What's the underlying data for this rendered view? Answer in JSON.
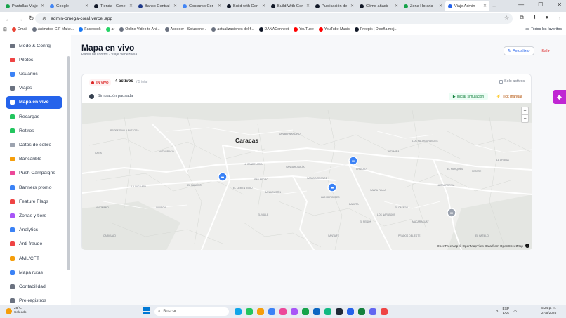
{
  "browser": {
    "tabs": [
      {
        "title": "Pantallas Viaje",
        "color": "#16a34a"
      },
      {
        "title": "Google",
        "color": "#4285f4"
      },
      {
        "title": "Tienda - Gene",
        "color": "#111827"
      },
      {
        "title": "Banco Central",
        "color": "#1e3a8a"
      },
      {
        "title": "Concurso Cor",
        "color": "#4285f4"
      },
      {
        "title": "Build with Ger",
        "color": "#111827"
      },
      {
        "title": "Build With Ger",
        "color": "#111827"
      },
      {
        "title": "Publicación de",
        "color": "#111827"
      },
      {
        "title": "Cómo añadir",
        "color": "#111827"
      },
      {
        "title": "Zona Horaria",
        "color": "#16a34a"
      },
      {
        "title": "Viaje Admin",
        "color": "#2563eb"
      }
    ],
    "url": "admin-omega-coral.vercel.app",
    "bookmarks": [
      {
        "label": "Gmail",
        "color": "#ea4335"
      },
      {
        "label": "Animated GIF Make...",
        "color": "#6b7280"
      },
      {
        "label": "Facebook",
        "color": "#1877f2"
      },
      {
        "label": "ar",
        "color": "#25d366"
      },
      {
        "label": "Online Video to Ani...",
        "color": "#6b7280"
      },
      {
        "label": "Acceder - Solucione...",
        "color": "#6b7280"
      },
      {
        "label": "actualizaciones del f...",
        "color": "#6b7280"
      },
      {
        "label": "DANAConnect",
        "color": "#111827"
      },
      {
        "label": "YouTube",
        "color": "#ff0000"
      },
      {
        "label": "YouTube Music",
        "color": "#ff0000"
      },
      {
        "label": "Freepik | Diseña mej...",
        "color": "#111827"
      }
    ],
    "all_bookmarks": "Todos los favoritos"
  },
  "sidebar": {
    "items": [
      {
        "label": "Modo & Config",
        "color": "#6b7280"
      },
      {
        "label": "Pilotos",
        "color": "#ef4444"
      },
      {
        "label": "Usuarios",
        "color": "#3b82f6"
      },
      {
        "label": "Viajes",
        "color": "#6b7280"
      },
      {
        "label": "Mapa en vivo",
        "color": "#ef4444",
        "active": true
      },
      {
        "label": "Recargas",
        "color": "#22c55e"
      },
      {
        "label": "Retiros",
        "color": "#22c55e"
      },
      {
        "label": "Datos de cobro",
        "color": "#9ca3af"
      },
      {
        "label": "Bancarible",
        "color": "#f59e0b"
      },
      {
        "label": "Push Campaigns",
        "color": "#ec4899"
      },
      {
        "label": "Banners promo",
        "color": "#3b82f6"
      },
      {
        "label": "Feature Flags",
        "color": "#ef4444"
      },
      {
        "label": "Zonas y tiers",
        "color": "#a855f7"
      },
      {
        "label": "Analytics",
        "color": "#3b82f6"
      },
      {
        "label": "Anti-fraude",
        "color": "#ef4444"
      },
      {
        "label": "AML/CFT",
        "color": "#f59e0b"
      },
      {
        "label": "Mapa rutas",
        "color": "#3b82f6"
      },
      {
        "label": "Contabilidad",
        "color": "#6b7280"
      },
      {
        "label": "Pre-registros",
        "color": "#6b7280"
      }
    ]
  },
  "header": {
    "title": "Mapa en vivo",
    "subtitle": "Panel de control · Viaje Venezuela",
    "refresh_label": "Actualizar",
    "logout_label": "Salir"
  },
  "panel": {
    "live_badge": "EN VIVO",
    "active_count": "4 activos",
    "total": "/ 5 total",
    "only_active": "Solo activos",
    "sim_status": "Simulación pausada",
    "start_sim": "Iniciar simulación",
    "tick": "Tick manual"
  },
  "map": {
    "city_label": "Caracas",
    "places": [
      "LA PASTORA",
      "ALTAGRACIA",
      "SAN BERNARDINO",
      "LA CANDELARIA",
      "SAN AGUSTÍN",
      "EL PARAÍSO",
      "CATIA",
      "PROPATRIA",
      "SANTA ROSALÍA",
      "SAN PEDRO",
      "EL CEMENTERIO",
      "LA VEGA",
      "EL VALLE",
      "CHACAO",
      "ALTAMIRA",
      "LOS PALOS GRANDES",
      "SABANA GRANDE",
      "LAS MERCEDES",
      "BARUTA",
      "EL CAFETAL",
      "PETARE",
      "LA URBINA",
      "LA CALIFORNIA",
      "EL MARQUÉS",
      "PRADOS DEL ESTE",
      "SANTA FE",
      "EL HATILLO",
      "LA YAGUARA",
      "ANTÍMANO",
      "CARICUAO",
      "MACARACUAY",
      "EL PEÑÓN",
      "SANTA PAULA",
      "LOS NARANJOS"
    ],
    "zoom_in": "+",
    "zoom_out": "−",
    "attribution": "OpenFreeMap © OpenMapTiles Data from OpenStreetMap"
  },
  "taskbar": {
    "temp": "28°C",
    "weather": "Soleado",
    "search": "Buscar",
    "lang1": "ESP",
    "lang2": "LAA",
    "time": "5:24 p. m.",
    "date": "27/5/2026"
  }
}
